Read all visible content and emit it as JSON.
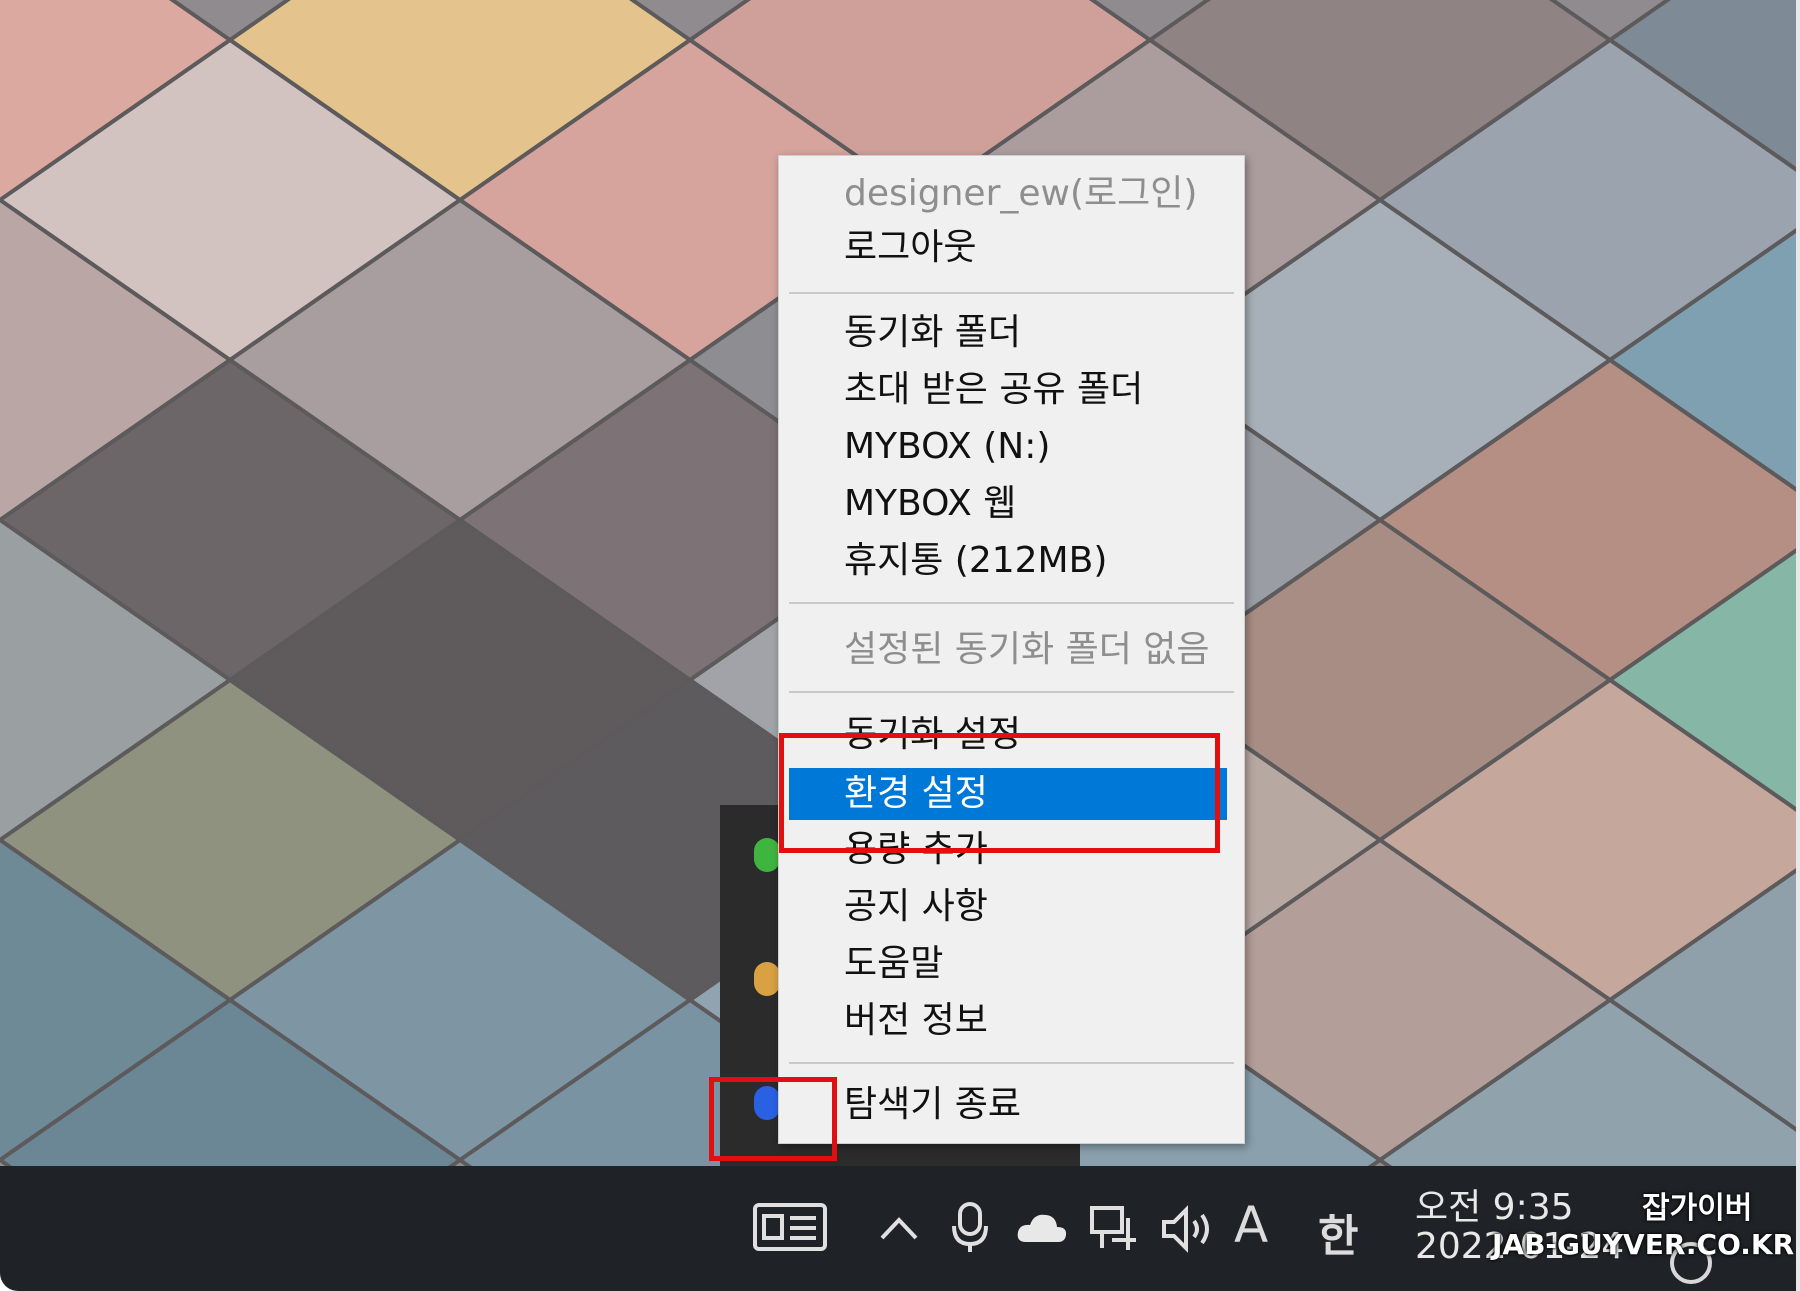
{
  "context_menu": {
    "account": "designer_ew(로그인)",
    "logout": "로그아웃",
    "sync_folder": "동기화 폴더",
    "shared_folder": "초대 받은 공유 폴더",
    "mybox_drive": "MYBOX (N:)",
    "mybox_web": "MYBOX 웹",
    "trash": "휴지통 (212MB)",
    "no_sync_folder": "설정된 동기화 폴더 없음",
    "sync_settings": "동기화 설정",
    "preferences": "환경 설정",
    "add_storage": "용량 추가",
    "notices": "공지 사항",
    "help": "도움말",
    "version_info": "버전 정보",
    "exit_explorer": "탐색기 종료"
  },
  "taskbar": {
    "ime_letter": "A",
    "ime_lang": "한",
    "time": "오전 9:35",
    "date": "2022-01-24"
  },
  "watermark": {
    "line1": "잡가이버",
    "line2": "JAB-GUYVER.CO.KR"
  },
  "colors": {
    "highlight": "#0078d7",
    "annotation": "#e01010",
    "taskbar": "#1f2327"
  },
  "icons": [
    "news-widget-icon",
    "chevron-up-icon",
    "meet-now-icon",
    "onedrive-cloud-icon",
    "network-icon",
    "volume-icon",
    "notification-icon"
  ]
}
